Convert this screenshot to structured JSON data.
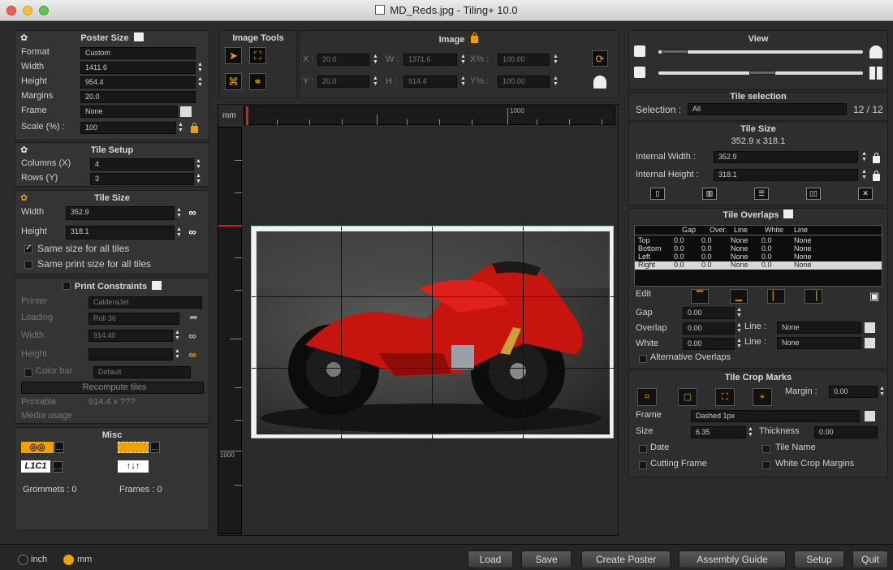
{
  "window": {
    "title": "MD_Reds.jpg - Tiling+ 10.0"
  },
  "poster_size": {
    "title": "Poster Size",
    "format_label": "Format",
    "format_value": "Custom",
    "width_label": "Width",
    "width_value": "1411.6",
    "height_label": "Height",
    "height_value": "954.4",
    "margins_label": "Margins",
    "margins_value": "20.0",
    "frame_label": "Frame",
    "frame_value": "None",
    "scale_label": "Scale (%) :",
    "scale_value": "100"
  },
  "tile_setup": {
    "title": "Tile Setup",
    "columns_label": "Columns (X)",
    "columns_value": "4",
    "rows_label": "Rows (Y)",
    "rows_value": "3"
  },
  "tile_size_left": {
    "title": "Tile Size",
    "width_label": "Width",
    "width_value": "352.9",
    "height_label": "Height",
    "height_value": "318.1",
    "same_size_label": "Same size for all tiles",
    "same_print_label": "Same print size for all tiles"
  },
  "print_constraints": {
    "title": "Print Constraints",
    "printer_label": "Printer",
    "printer_value": "CalderaJet",
    "loading_label": "Loading",
    "loading_value": "Roll 36",
    "width_label": "Width",
    "width_value": "914.40",
    "height_label": "Height",
    "height_value": "",
    "colorbar_label": "Color bar",
    "colorbar_value": "Default",
    "recompute_label": "Recompute tiles",
    "printable_label": "Printable",
    "printable_value": "914.4 x ???",
    "media_label": "Media usage"
  },
  "misc": {
    "title": "Misc",
    "grommets_label": "Grommets : 0",
    "frames_label": "Frames : 0",
    "l1c1_label": "L1C1",
    "arrows_label": "↑↓↑"
  },
  "image_tools": {
    "title": "Image Tools"
  },
  "image": {
    "title": "Image",
    "x_label": "X :",
    "x_value": "20.0",
    "y_label": "Y :",
    "y_value": "20.0",
    "w_label": "W :",
    "w_value": "1371.6",
    "h_label": "H :",
    "h_value": "914.4",
    "xpct_label": "X% :",
    "xpct_value": "100.00",
    "ypct_label": "Y% :",
    "ypct_value": "100.00"
  },
  "ruler": {
    "unit": "mm",
    "h_mark": "1000",
    "v_mark": "1000"
  },
  "view": {
    "title": "View"
  },
  "tile_selection": {
    "title": "Tile selection",
    "label": "Selection :",
    "value": "All",
    "count": "12 / 12"
  },
  "tile_size_right": {
    "title": "Tile Size",
    "dims": "352.9 x 318.1",
    "internal_width_label": "Internal Width :",
    "internal_width_value": "352.9",
    "internal_height_label": "Internal Height :",
    "internal_height_value": "318.1"
  },
  "tile_overlaps": {
    "title": "Tile Overlaps",
    "columns": [
      "Gap",
      "Over.",
      "Line",
      "White",
      "Line"
    ],
    "rows": [
      {
        "name": "Top",
        "gap": "0.0",
        "over": "0.0",
        "line": "None",
        "white": "0.0",
        "line2": "None"
      },
      {
        "name": "Bottom",
        "gap": "0.0",
        "over": "0.0",
        "line": "None",
        "white": "0.0",
        "line2": "None"
      },
      {
        "name": "Left",
        "gap": "0.0",
        "over": "0.0",
        "line": "None",
        "white": "0.0",
        "line2": "None"
      },
      {
        "name": "Right",
        "gap": "0.0",
        "over": "0.0",
        "line": "None",
        "white": "0.0",
        "line2": "None"
      }
    ],
    "edit_label": "Edit",
    "gap_label": "Gap",
    "gap_value": "0.00",
    "overlap_label": "Overlap",
    "overlap_value": "0.00",
    "white_label": "White",
    "white_value": "0.00",
    "line_label": "Line :",
    "line1_value": "None",
    "line2_value": "None",
    "alt_label": "Alternative Overlaps"
  },
  "tile_crop_marks": {
    "title": "Tile Crop Marks",
    "margin_label": "Margin :",
    "margin_value": "0.00",
    "frame_label": "Frame",
    "frame_value": "Dashed 1px",
    "size_label": "Size",
    "size_value": "6.35",
    "thickness_label": "Thickness",
    "thickness_value": "0.00",
    "date_label": "Date",
    "tile_name_label": "Tile Name",
    "cutting_frame_label": "Cutting Frame",
    "white_crop_label": "White Crop Margins"
  },
  "bottom": {
    "inch_label": "inch",
    "mm_label": "mm",
    "load_label": "Load",
    "save_label": "Save",
    "create_label": "Create Poster",
    "assembly_label": "Assembly Guide",
    "setup_label": "Setup",
    "quit_label": "Quit"
  },
  "colors": {
    "accent": "#f0a000",
    "bike": "#d11a14",
    "panel": "#343434",
    "guide": "#8fd1b0"
  }
}
